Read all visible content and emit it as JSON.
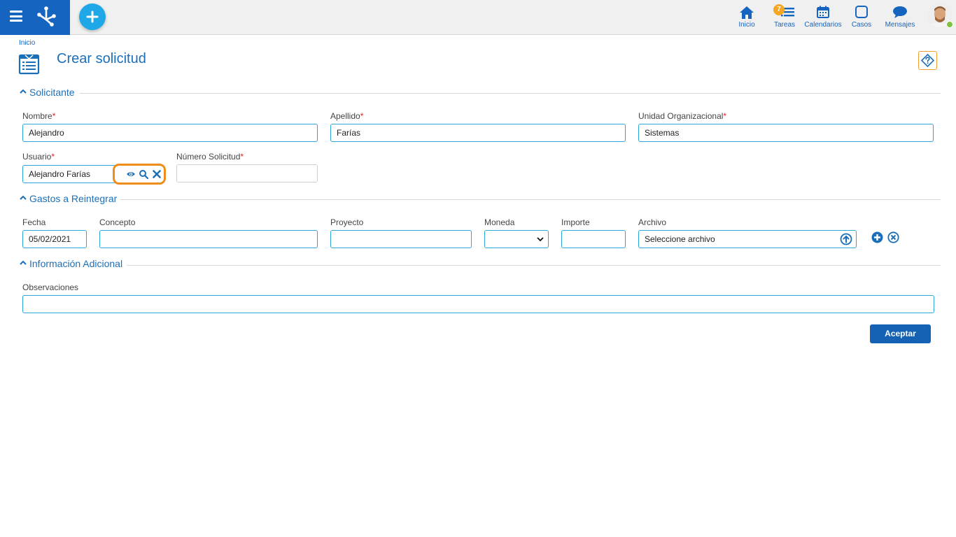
{
  "header": {
    "nav": [
      {
        "label": "Inicio",
        "icon": "home-icon"
      },
      {
        "label": "Tareas",
        "icon": "tasks-icon",
        "badge": "7"
      },
      {
        "label": "Calendarios",
        "icon": "calendar-icon"
      },
      {
        "label": "Casos",
        "icon": "cases-icon"
      },
      {
        "label": "Mensajes",
        "icon": "messages-icon"
      }
    ],
    "user_status_color": "#7dc243",
    "brand_color": "#1565c0"
  },
  "breadcrumb": "Inicio",
  "page": {
    "title": "Crear solicitud"
  },
  "sections": {
    "solicitante": {
      "title": "Solicitante",
      "nombre": {
        "label": "Nombre",
        "value": "Alejandro"
      },
      "apellido": {
        "label": "Apellido",
        "value": "Farías"
      },
      "unidad": {
        "label": "Unidad Organizacional",
        "value": "Sistemas"
      },
      "usuario": {
        "label": "Usuario",
        "value": "Alejandro Farías"
      },
      "numero": {
        "label": "Número Solicitud",
        "value": ""
      },
      "required_mark": "*"
    },
    "gastos": {
      "title": "Gastos a Reintegrar",
      "fecha": {
        "label": "Fecha",
        "value": "05/02/2021"
      },
      "concepto": {
        "label": "Concepto",
        "value": ""
      },
      "proyecto": {
        "label": "Proyecto",
        "value": ""
      },
      "moneda": {
        "label": "Moneda",
        "value": ""
      },
      "importe": {
        "label": "Importe",
        "value": ""
      },
      "archivo": {
        "label": "Archivo",
        "placeholder": "Seleccione archivo"
      }
    },
    "info": {
      "title": "Información Adicional",
      "observaciones": {
        "label": "Observaciones",
        "value": ""
      }
    }
  },
  "actions": {
    "accept": "Aceptar"
  }
}
